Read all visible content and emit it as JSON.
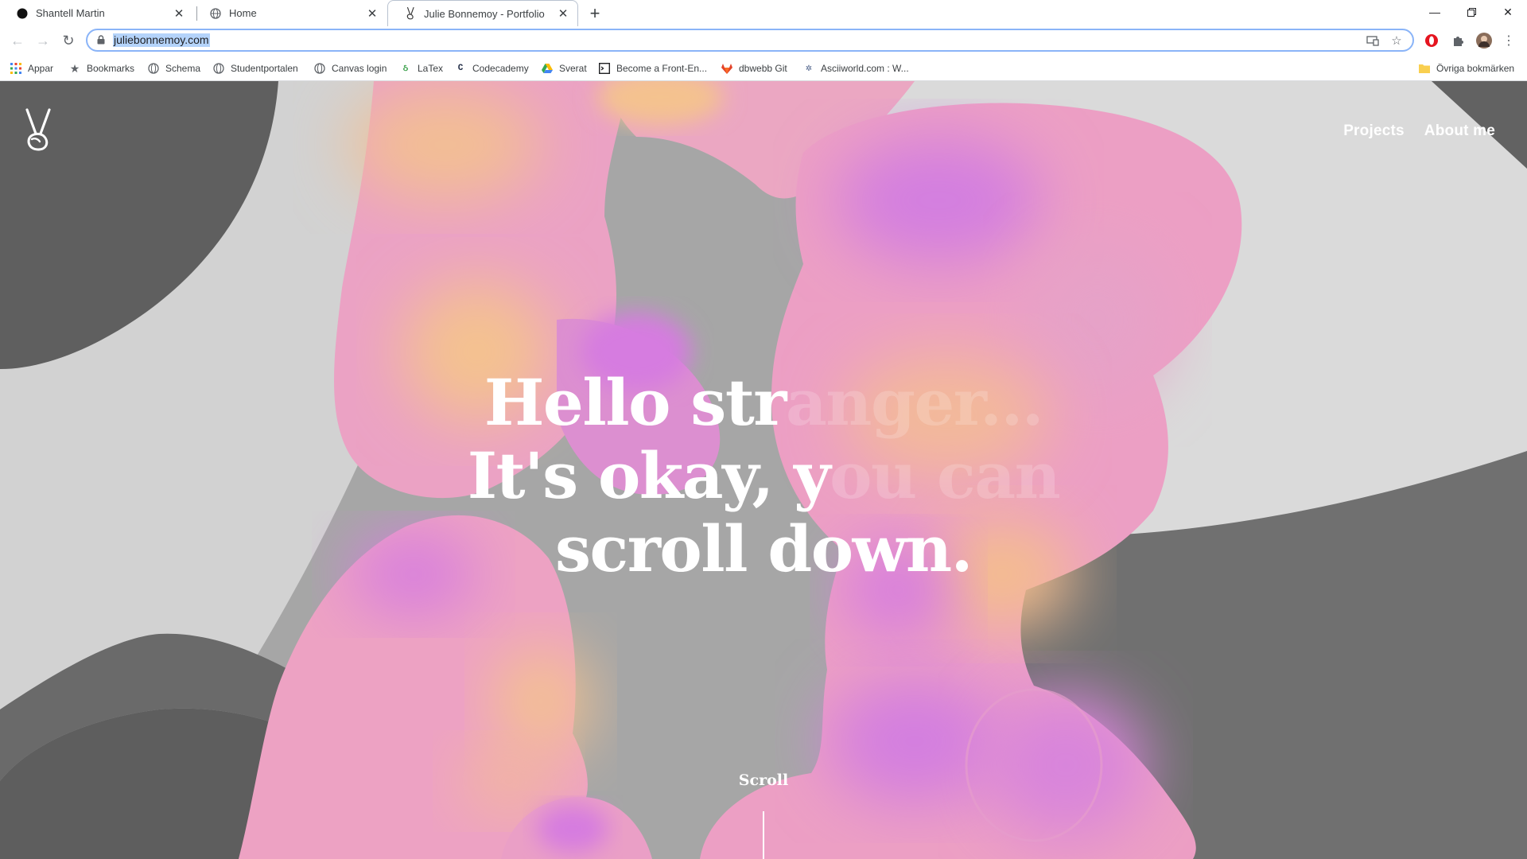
{
  "browser": {
    "tabs": [
      {
        "title": "Shantell Martin",
        "active": false
      },
      {
        "title": "Home",
        "active": false
      },
      {
        "title": "Julie Bonnemoy - Portfolio",
        "active": true
      }
    ],
    "address": "juliebonnemoy.com",
    "bookmarks": [
      {
        "label": "Appar",
        "icon": "apps-grid-icon"
      },
      {
        "label": "Bookmarks",
        "icon": "star-icon"
      },
      {
        "label": "Schema",
        "icon": "globe-icon"
      },
      {
        "label": "Studentportalen",
        "icon": "globe-icon"
      },
      {
        "label": "Canvas login",
        "icon": "globe-icon"
      },
      {
        "label": "LaTex",
        "icon": "latex-icon"
      },
      {
        "label": "Codecademy",
        "icon": "codecademy-icon"
      },
      {
        "label": "Sverat",
        "icon": "drive-icon"
      },
      {
        "label": "Become a Front-En...",
        "icon": "terminal-icon"
      },
      {
        "label": "dbwebb Git",
        "icon": "gitlab-icon"
      },
      {
        "label": "Asciiworld.com : W...",
        "icon": "ascii-icon"
      }
    ],
    "other_bookmarks": "Övriga bokmärken"
  },
  "site": {
    "nav": [
      "Projects",
      "About me"
    ],
    "hero": {
      "line1_visible": "Hello str",
      "line1_faded": "anger...",
      "line2_visible": "It's okay, y",
      "line2_faded": "ou can",
      "line3": "scroll down."
    },
    "scroll_label": "Scroll"
  },
  "colors": {
    "page_bg": "#a4a4a4",
    "dark_shape": "#5f5f5f",
    "light_shape": "#dcdcdc",
    "blob_pink": "#ec9dc6",
    "blob_violet": "#d27ce0",
    "blob_peach": "#f4c28f"
  }
}
